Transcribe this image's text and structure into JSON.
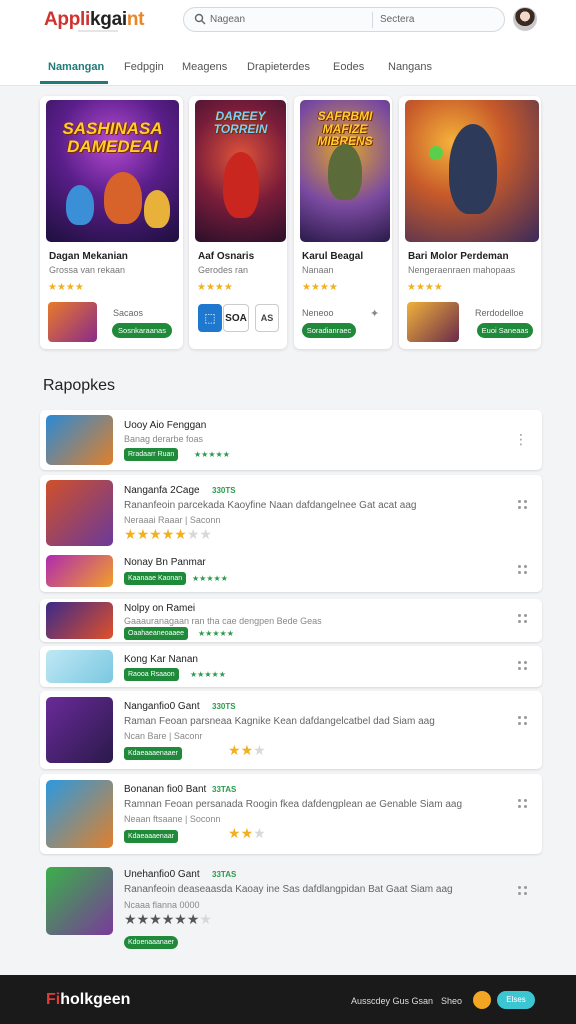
{
  "header": {
    "logo_part1": "Appli",
    "logo_part2": "kgai",
    "logo_part3": "nt",
    "search_placeholder": "Nagean",
    "search_placeholder_2": "Sectera"
  },
  "tabs": [
    "Namangan",
    "Fedpgin",
    "Meagens",
    "Drapieterdes",
    "Eodes",
    "Nangans"
  ],
  "featured": [
    {
      "art_title": "SASHINASA DAMEDEAI",
      "title": "Dagan Mekanian",
      "subtitle": "Grossa van rekaan",
      "stars": "★★★★",
      "label": "Sacaos",
      "button": "Sosnkaraanas"
    },
    {
      "art_title": "DAREEY TORREIN",
      "title": "Aaf Osnaris",
      "subtitle": "Gerodes ran",
      "stars": "★★★★",
      "mini1": "SOA",
      "mini2": "AS",
      "button": ""
    },
    {
      "art_title": "SAFRBMI MAFIZE MIBRENS",
      "title": "Karul Beagal",
      "subtitle": "Nanaan",
      "stars": "★★★★",
      "label": "Neneoo",
      "button": "Soradianraec"
    },
    {
      "art_title": "",
      "title": "Bari Molor Perdeman",
      "subtitle": "Nengeraenraen mahopaas",
      "stars": "★★★★",
      "label": "Rerdodelloe",
      "button": "Euoi Saneaas"
    }
  ],
  "section_title": "Rapopkes",
  "list": [
    {
      "title": "Uooy Aio Fenggan",
      "badge": "",
      "desc": "Banag derarbe foas",
      "meta": "",
      "button": "Rradaarr Ruan",
      "small_stars": "★★★★★",
      "rating": 0
    },
    {
      "title": "Nanganfa 2Cage",
      "badge": "330TS",
      "desc": "Rananfeoin parcekada Kaoyfine Naan dafdangelnee Gat acat aag",
      "meta": "Neraaai Raaar | Saconn",
      "button": "",
      "small_stars": "",
      "rating": 5
    },
    {
      "title": "Nonay Bn Panmar",
      "badge": "",
      "desc": "",
      "meta": "",
      "button": "Kaanaae Kaonan",
      "small_stars": "★★★★★",
      "rating": 0
    },
    {
      "title": "Nolpy on Ramei",
      "badge": "",
      "desc": "Gaaauranagaan ran tha cae dengpen Bede Geas",
      "meta": "",
      "button": "Oaahaeaneoaaee",
      "small_stars": "★★★★★",
      "rating": 0
    },
    {
      "title": "Kong Kar Nanan",
      "badge": "",
      "desc": "",
      "meta": "",
      "button": "Raooa Rsaaon",
      "small_stars": "★★★★★",
      "rating": 0
    },
    {
      "title": "Nanganfio0 Gant",
      "badge": "330TS",
      "desc": "Raman Feoan parsneaa Kagnike Kean dafdangelcatbel dad Siam aag",
      "meta": "Ncan Bare | Saconr",
      "button": "Kdaeaaaenaaer",
      "small_stars": "",
      "rating": 2
    },
    {
      "title": "Bonanan fio0 Bant",
      "badge": "33TAS",
      "desc": "Ramnan Feoan persanada Roogin fkea dafdengplean ae Genable Siam aag",
      "meta": "Neaan ftsaane | Soconn",
      "button": "Kdaeaaaenaar",
      "small_stars": "",
      "rating": 2
    },
    {
      "title": "Unehanfio0 Gant",
      "badge": "33TAS",
      "desc": "Rananfeoin deaseaasda Kaoay ine Sas dafdlangpidan Bat Gaat Siam aag",
      "meta": "Ncaaa flanna 0000",
      "button": "Kdoenaaanaer",
      "small_stars": "",
      "rating": 6
    }
  ],
  "footer": {
    "logo_a": "Fi",
    "logo_b": "holkgeen",
    "link1": "Ausscdey Gus Gsan",
    "link2": "Sheo",
    "pill": "Elses"
  }
}
